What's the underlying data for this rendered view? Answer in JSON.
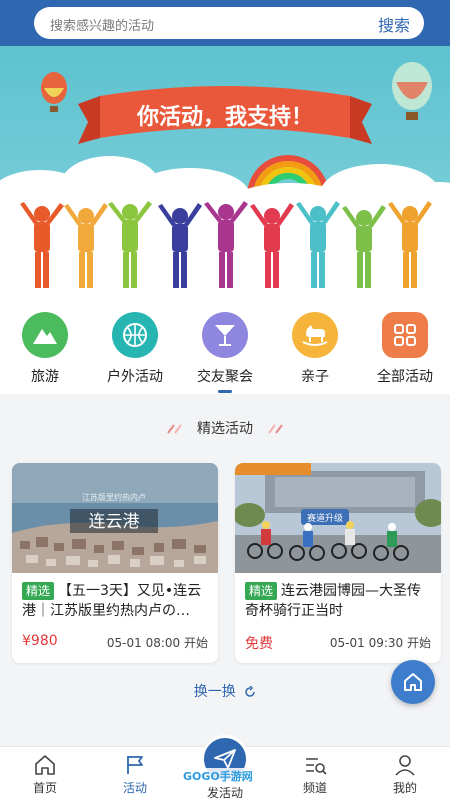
{
  "search": {
    "placeholder": "搜索感兴趣的活动",
    "button": "搜索"
  },
  "banner": {
    "slogan": "你活动，我支持！"
  },
  "categories": [
    {
      "label": "旅游",
      "icon": "mountain-icon",
      "color": "#4cbb5e"
    },
    {
      "label": "户外活动",
      "icon": "basketball-icon",
      "color": "#27b5b1"
    },
    {
      "label": "交友聚会",
      "icon": "cocktail-icon",
      "color": "#8f86e0"
    },
    {
      "label": "亲子",
      "icon": "rocking-horse-icon",
      "color": "#f6b53a"
    },
    {
      "label": "全部活动",
      "icon": "grid-icon",
      "color": "#ef7d4a"
    }
  ],
  "featured": {
    "title": "精选活动",
    "cards": [
      {
        "tag": "精选",
        "title": "【五一3天】又见•连云港｜江苏版里约热内卢の…",
        "price": "¥980",
        "date": "05-01 08:00 开始",
        "image_caption": "江苏版里约热内卢",
        "image_title": "连云港"
      },
      {
        "tag": "精选",
        "title": "连云港园博园—大圣传奇杯骑行正当时",
        "price": "免费",
        "date": "05-01 09:30 开始",
        "image_badge": "赛道升级"
      }
    ]
  },
  "refresh_label": "换一换",
  "tabbar": {
    "items": [
      {
        "label": "首页",
        "icon": "home-icon"
      },
      {
        "label": "活动",
        "icon": "flag-icon",
        "active": true
      },
      {
        "label": "发活动",
        "icon": "paper-plane-icon"
      },
      {
        "label": "频道",
        "icon": "channel-icon"
      },
      {
        "label": "我的",
        "icon": "user-icon"
      }
    ]
  },
  "watermark": "GOGO手游网",
  "colors": {
    "primary": "#2f67b1",
    "tag_green": "#34a853",
    "price_red": "#e23a3a"
  }
}
